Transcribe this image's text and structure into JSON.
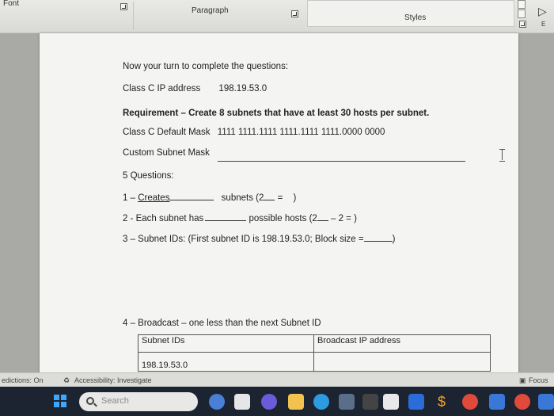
{
  "ribbon": {
    "font_label": "Font",
    "paragraph_label": "Paragraph",
    "styles_label": "Styles",
    "editing_label": "E"
  },
  "document": {
    "intro": "Now your turn to complete the questions:",
    "class_ip_label": "Class C IP address",
    "class_ip_value": "198.19.53.0",
    "requirement_label": "Requirement",
    "requirement_dash": " – ",
    "requirement_text": "Create 8 subnets that have at least 30 hosts per subnet.",
    "default_mask_label": "Class C Default Mask",
    "default_mask_value": "1111 1111.1111 1111.1111 1111.0000 0000",
    "custom_mask_label": "Custom Subnet Mask",
    "questions_label": "5 Questions:",
    "q1_prefix": "1 – ",
    "q1_word": "Creates",
    "q1_suffix": "subnets (2",
    "q1_eq": "= ",
    "q1_close": ")",
    "q2_prefix": "2 - Each subnet has",
    "q2_suffix": "possible hosts (2",
    "q2_eq": "– 2 = )",
    "q3_text": "3 – Subnet IDs: (First subnet ID is 198.19.53.0; Block size =",
    "q3_close": ")",
    "q4_text": "4 – Broadcast – one less than the next Subnet ID",
    "table": {
      "col_subnet": "Subnet IDs",
      "col_broadcast": "Broadcast IP address",
      "row1_subnet": "198.19.53.0"
    }
  },
  "status": {
    "predictions": "edictions: On",
    "accessibility": "Accessibility: Investigate",
    "focus": "Focus"
  },
  "taskbar": {
    "search_placeholder": "Search"
  },
  "colors": {
    "page": "#f4f4f2",
    "taskbar": "#1b2430",
    "windows_blue": "#3ea6ff"
  }
}
